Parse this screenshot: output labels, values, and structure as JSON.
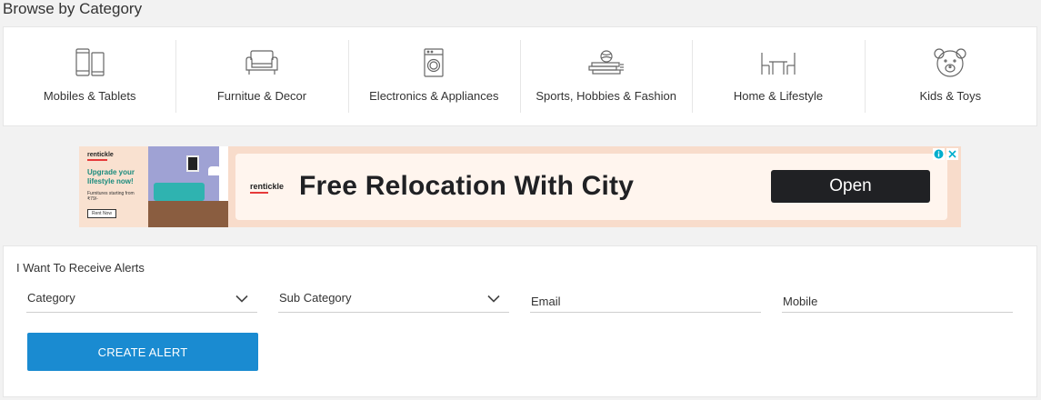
{
  "page": {
    "section_title": "Browse by Category"
  },
  "categories": [
    {
      "label": "Mobiles & Tablets",
      "icon": "mobile-tablet-icon"
    },
    {
      "label": "Furnitue & Decor",
      "icon": "sofa-icon"
    },
    {
      "label": "Electronics & Appliances",
      "icon": "washing-machine-icon"
    },
    {
      "label": "Sports, Hobbies & Fashion",
      "icon": "ball-books-icon"
    },
    {
      "label": "Home & Lifestyle",
      "icon": "table-chairs-icon"
    },
    {
      "label": "Kids & Toys",
      "icon": "teddy-bear-icon"
    }
  ],
  "ad": {
    "left_brand": "rentickle",
    "left_headline": "Upgrade your lifestyle now!",
    "left_sub": "Furnitures starting from ₹79/-",
    "left_button": "Rent Now",
    "card_brand": "rentickle",
    "title": "Free Relocation With City",
    "cta": "Open",
    "background": "#f8dccb"
  },
  "alerts": {
    "title": "I Want To Receive Alerts",
    "category_label": "Category",
    "subcategory_label": "Sub Category",
    "email_placeholder": "Email",
    "mobile_placeholder": "Mobile",
    "button_label": "CREATE ALERT",
    "accent": "#1a8bd1"
  }
}
